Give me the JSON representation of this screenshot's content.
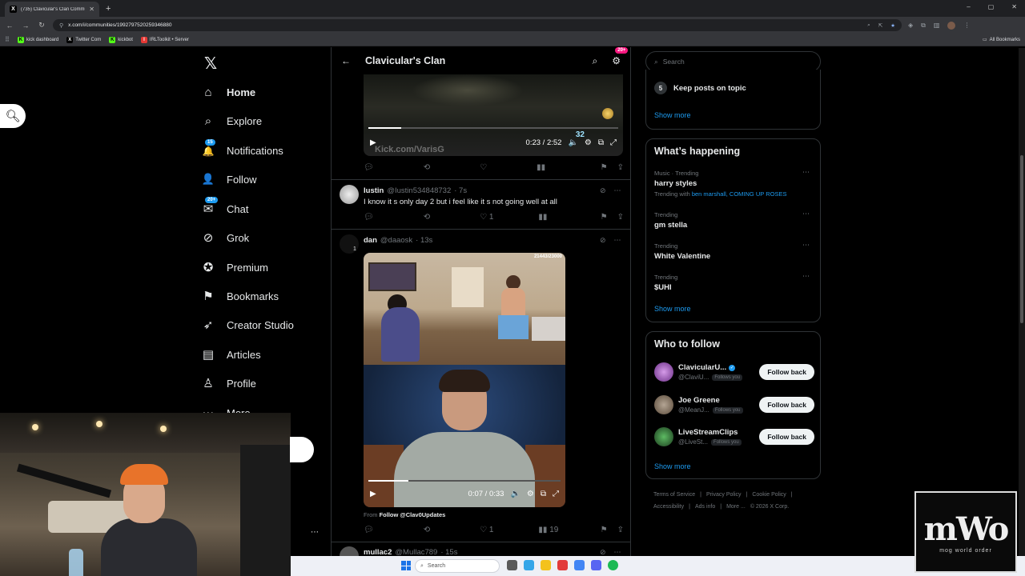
{
  "browser": {
    "tab_title": "(735) Clavicular's Clan Commu...",
    "tab_favicon": "X",
    "url": "x.com/i/communities/1992797520259346880",
    "bookmarks": [
      {
        "label": "kick dashboard",
        "icon_text": "K",
        "color": "#53fc18"
      },
      {
        "label": "Twitter Com",
        "icon_text": "X",
        "color": "#000000"
      },
      {
        "label": "kickbot",
        "icon_text": "K",
        "color": "#53fc18"
      },
      {
        "label": "IRLToolkit • Server",
        "icon_text": "I",
        "color": "#e53935"
      }
    ],
    "all_bookmarks": "All Bookmarks"
  },
  "nav": {
    "logo": "𝕏",
    "items": [
      {
        "label": "Home",
        "icon": "⌂",
        "bold": true
      },
      {
        "label": "Explore",
        "icon": "⌕"
      },
      {
        "label": "Notifications",
        "icon": "🔔",
        "badge": "15"
      },
      {
        "label": "Follow",
        "icon": "👤"
      },
      {
        "label": "Chat",
        "icon": "✉",
        "badge": "20+"
      },
      {
        "label": "Grok",
        "icon": "⊘"
      },
      {
        "label": "Premium",
        "icon": "✪"
      },
      {
        "label": "Bookmarks",
        "icon": "⚑"
      },
      {
        "label": "Creator Studio",
        "icon": "➶"
      },
      {
        "label": "Articles",
        "icon": "▤"
      },
      {
        "label": "Profile",
        "icon": "♙"
      },
      {
        "label": "More",
        "icon": "⋯"
      }
    ]
  },
  "community": {
    "title": "Clavicular's Clan",
    "notif_badge": "20+"
  },
  "video1": {
    "time": "0:23 / 2:52",
    "watermark": "Kick.com/VarisG",
    "overlay_num": "32",
    "progress": 0.13
  },
  "post1": {
    "name": "Iustin",
    "handle": "@Iustin534848732",
    "time": "· 7s",
    "text": "I know it s only day 2 but i feel like it s not going well at all",
    "likes": "1"
  },
  "post2": {
    "name": "dan",
    "handle": "@daaosk",
    "time": "· 13s",
    "replies_indicator": "1",
    "overlay_hud": "21443/23000",
    "video_time": "0:07 / 0:33",
    "progress": 0.21,
    "from_prefix": "From",
    "from_link": "Follow @Clav0Updates",
    "likes": "1",
    "views": "19"
  },
  "post3": {
    "name": "mullac2",
    "handle": "@Mullac789",
    "time": "· 15s"
  },
  "right": {
    "search_placeholder": "Search",
    "rule_num": "5",
    "rule_text": "Keep posts on topic",
    "show_more": "Show more",
    "happening_title": "What’s happening",
    "trends": [
      {
        "context": "Music · Trending",
        "topic": "harry styles",
        "sub_prefix": "Trending with ",
        "sub_links": "ben marshall, COMING UP ROSES"
      },
      {
        "context": "Trending",
        "topic": "gm stella"
      },
      {
        "context": "Trending",
        "topic": "White Valentine"
      },
      {
        "context": "Trending",
        "topic": "$UHI"
      }
    ],
    "wtf_title": "Who to follow",
    "follow_label": "Follow back",
    "follows_you": "Follows you",
    "accounts": [
      {
        "name": "ClavicularU...",
        "handle": "@ClaviU...",
        "verified": true,
        "color": "#b06ac9"
      },
      {
        "name": "Joe Greene",
        "handle": "@MeanJ...",
        "verified": false,
        "color": "#8a7a6a"
      },
      {
        "name": "LiveStreamClips",
        "handle": "@LiveSt...",
        "verified": false,
        "color": "#2e7d32"
      }
    ],
    "footer": [
      "Terms of Service",
      "|",
      "Privacy Policy",
      "|",
      "Cookie Policy",
      "|",
      "Accessibility",
      "|",
      "Ads info",
      "|",
      "More ...",
      "© 2026 X Corp."
    ]
  },
  "taskbar": {
    "search_placeholder": "Search"
  },
  "logo_overlay": {
    "big": "mWo",
    "small": "mog world order"
  }
}
